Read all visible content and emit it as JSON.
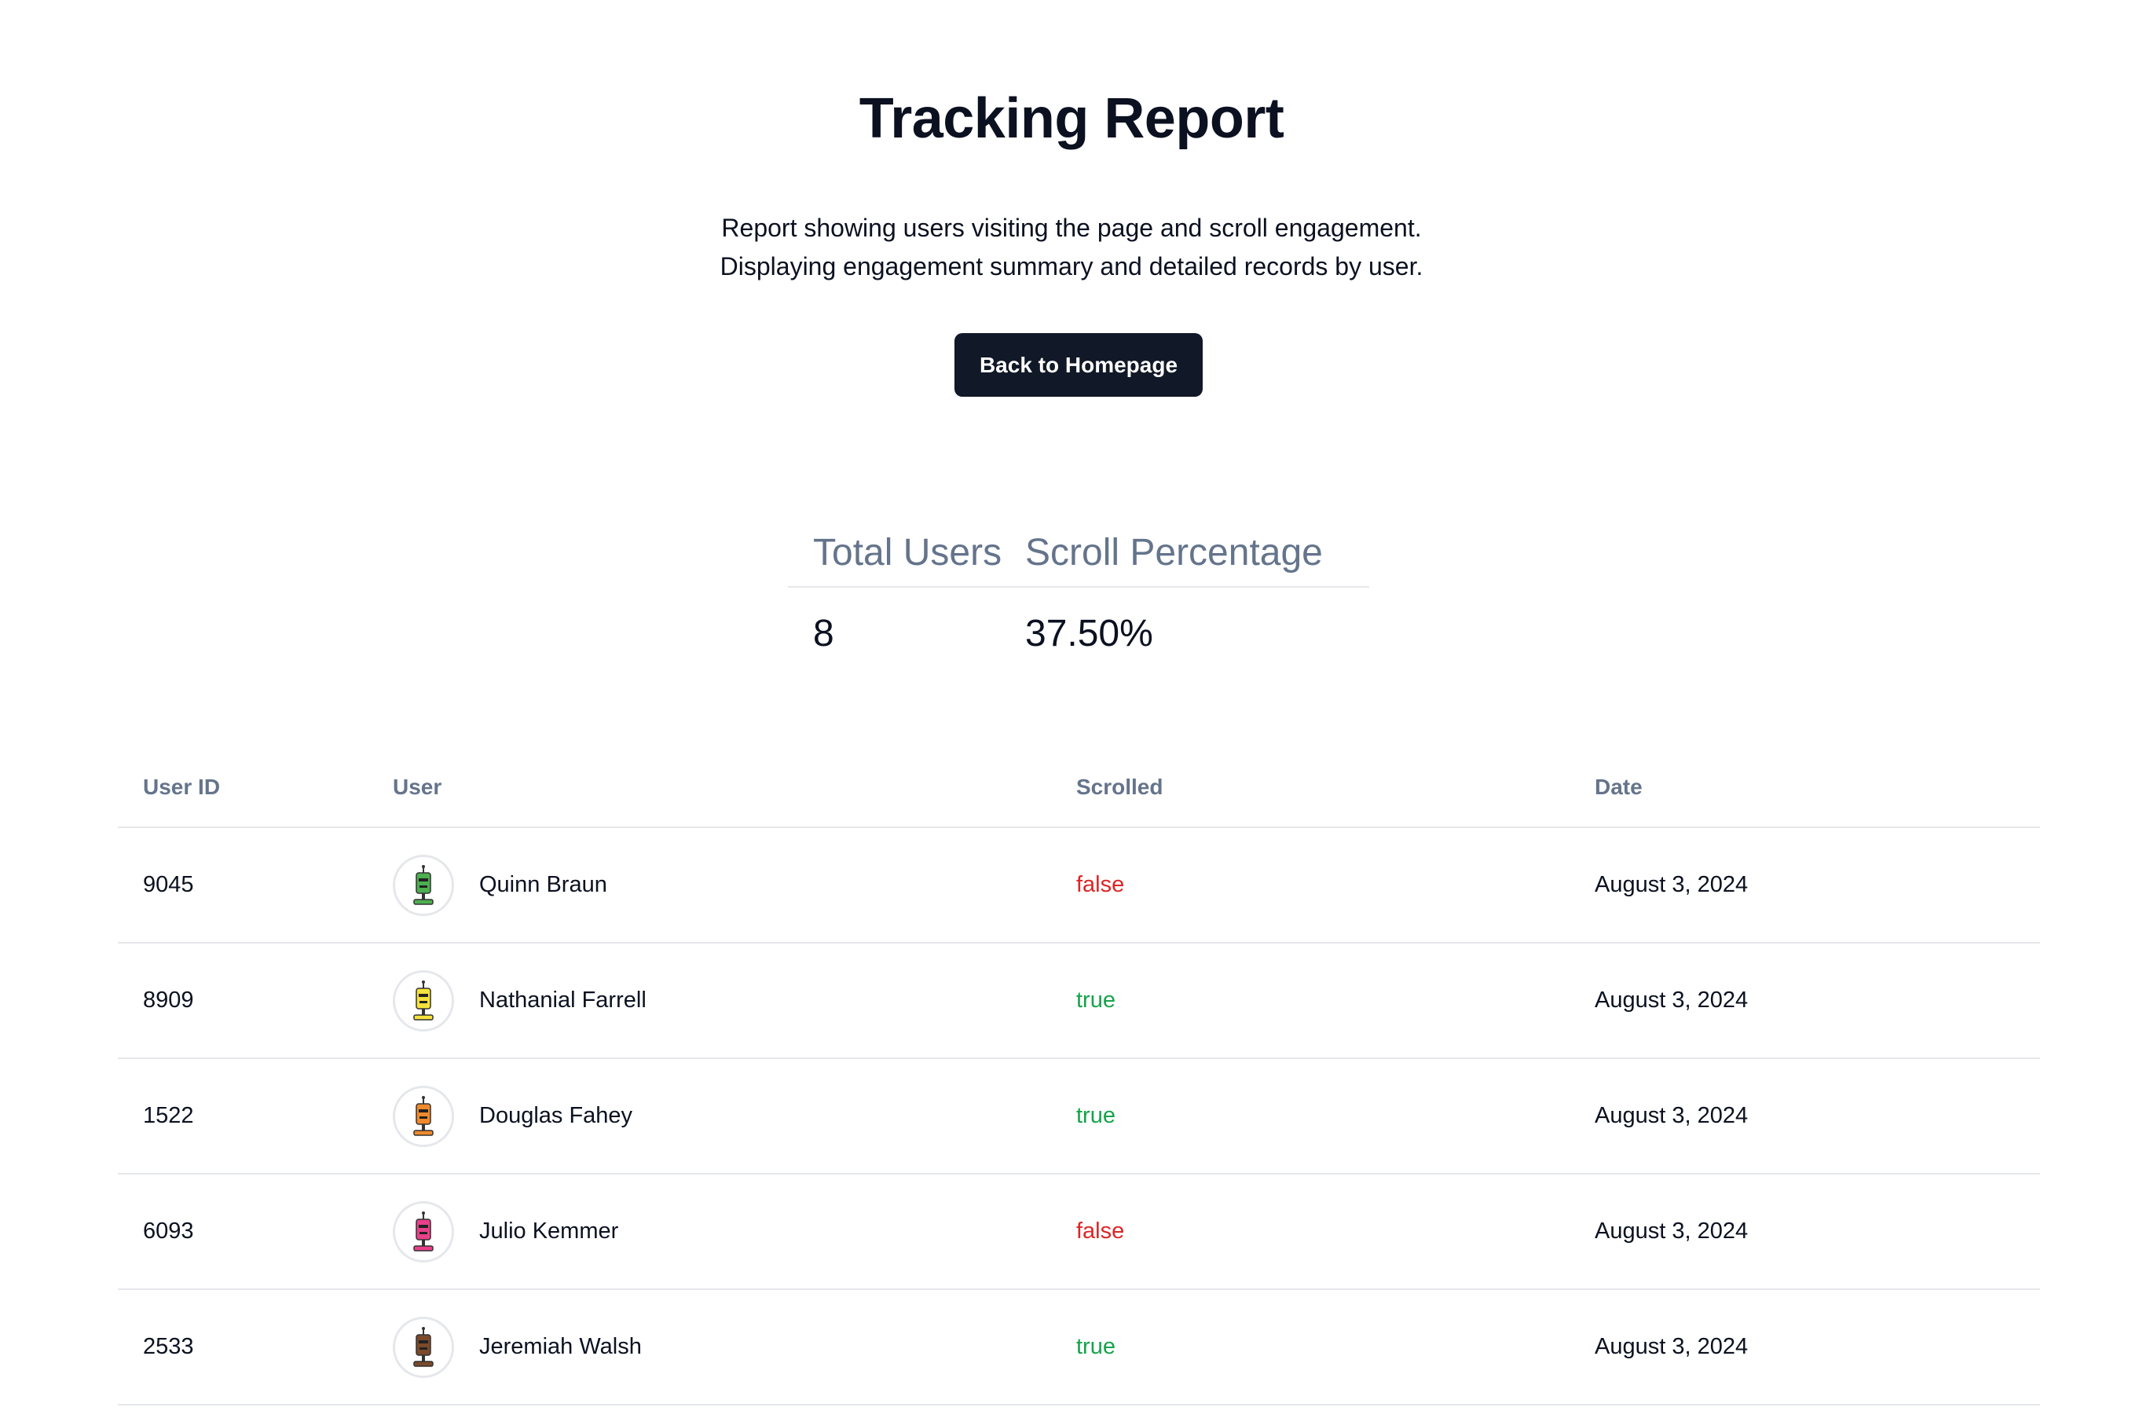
{
  "header": {
    "title": "Tracking Report",
    "subtitle_line1": "Report showing users visiting the page and scroll engagement.",
    "subtitle_line2": "Displaying engagement summary and detailed records by user.",
    "back_button": "Back to Homepage"
  },
  "summary": {
    "headers": [
      "Total Users",
      "Scroll Percentage"
    ],
    "values": [
      "8",
      "37.50%"
    ]
  },
  "records": {
    "headers": [
      "User ID",
      "User",
      "Scrolled",
      "Date"
    ],
    "rows": [
      {
        "id": "9045",
        "name": "Quinn Braun",
        "scrolled": "false",
        "date": "August 3, 2024",
        "avatar_color": "#4caf50",
        "avatar_icon": "robot-green-avatar"
      },
      {
        "id": "8909",
        "name": "Nathanial Farrell",
        "scrolled": "true",
        "date": "August 3, 2024",
        "avatar_color": "#f5e23c",
        "avatar_icon": "robot-yellow-avatar"
      },
      {
        "id": "1522",
        "name": "Douglas Fahey",
        "scrolled": "true",
        "date": "August 3, 2024",
        "avatar_color": "#f08a2c",
        "avatar_icon": "robot-orange-avatar"
      },
      {
        "id": "6093",
        "name": "Julio Kemmer",
        "scrolled": "false",
        "date": "August 3, 2024",
        "avatar_color": "#e8408a",
        "avatar_icon": "robot-pink-avatar"
      },
      {
        "id": "2533",
        "name": "Jeremiah Walsh",
        "scrolled": "true",
        "date": "August 3, 2024",
        "avatar_color": "#7a4a2a",
        "avatar_icon": "robot-brown-avatar"
      }
    ]
  },
  "colors": {
    "false": "#dc2626",
    "true": "#16a34a",
    "button_bg": "#111827"
  }
}
